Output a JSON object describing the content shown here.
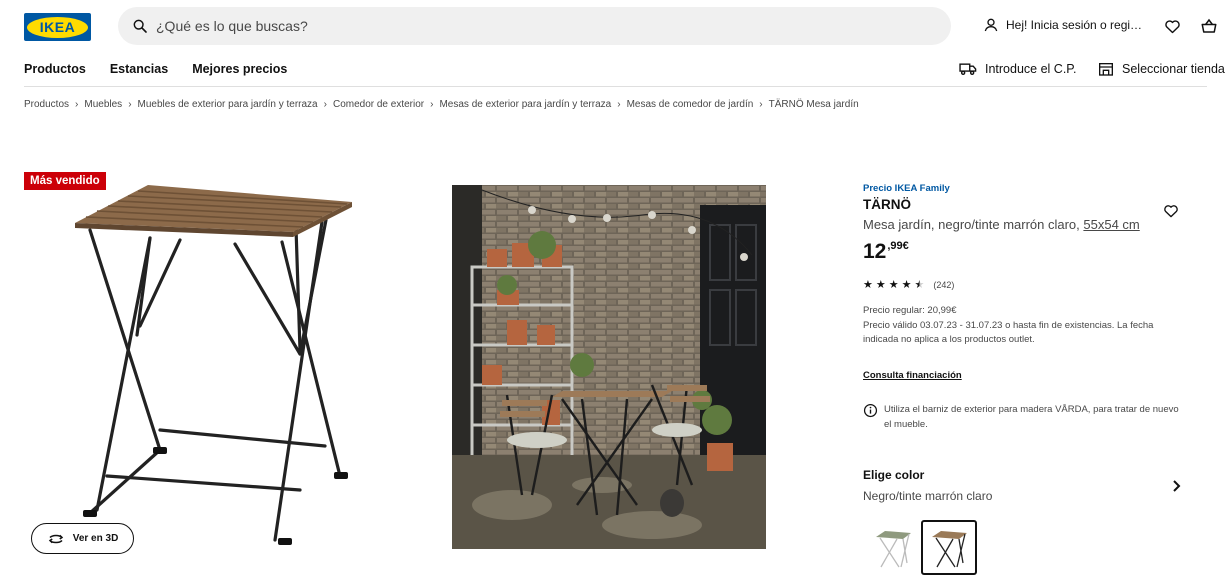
{
  "header": {
    "logo_text": "IKEA",
    "search_placeholder": "¿Qué es lo que buscas?",
    "account_label": "Hej! Inicia sesión o regi…"
  },
  "nav": {
    "items": [
      "Productos",
      "Estancias",
      "Mejores precios"
    ],
    "postcode": "Introduce el C.P.",
    "store": "Seleccionar tienda"
  },
  "breadcrumb": [
    "Productos",
    "Muebles",
    "Muebles de exterior para jardín y terraza",
    "Comedor de exterior",
    "Mesas de exterior para jardín y terraza",
    "Mesas de comedor de jardín",
    "TÄRNÖ Mesa jardín"
  ],
  "gallery": {
    "badge": "Más vendido",
    "view3d": "Ver en 3D"
  },
  "product": {
    "family_label": "Precio IKEA Family",
    "name": "TÄRNÖ",
    "description": "Mesa jardín, negro/tinte marrón claro, ",
    "size": "55x54 cm",
    "price_int": "12",
    "price_dec": ",99€",
    "rating": 4.5,
    "review_count": "(242)",
    "regular_price": "Precio regular: 20,99€",
    "validity": "Precio válido 03.07.23 - 31.07.23 o hasta fin de existencias. La fecha indicada no aplica a los productos outlet.",
    "financing": "Consulta financiación",
    "info": "Utiliza el barniz de exterior para madera VÅRDA, para tratar de nuevo el mueble.",
    "choose_color": "Elige color",
    "selected_color": "Negro/tinte marrón claro"
  },
  "colors": {
    "ikea_blue": "#0058a3",
    "ikea_yellow": "#ffdb00",
    "badge_red": "#cc0008",
    "wood": "#a07e5c",
    "frame": "#222222"
  }
}
